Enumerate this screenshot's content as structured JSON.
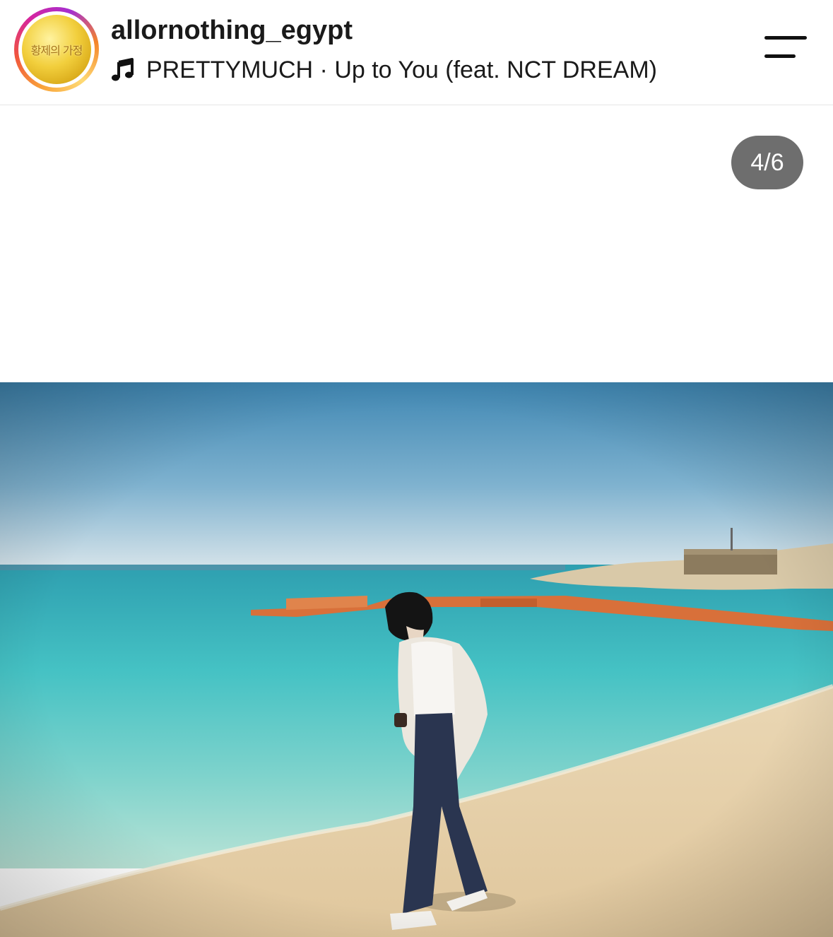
{
  "post": {
    "username": "allornothing_egypt",
    "music": {
      "icon": "music-note-icon",
      "text": "PRETTYMUCH · Up to You (feat. NCT DREAM)"
    },
    "avatar_text": "황제의 가정",
    "menu_icon": "menu-icon",
    "carousel_counter": "4/6",
    "colors": {
      "story_ring": [
        "#f9a43a",
        "#f0553d",
        "#d6249f",
        "#a42fd1"
      ],
      "counter_bg": "#6e6e6e",
      "text": "#1a1a1a"
    }
  }
}
